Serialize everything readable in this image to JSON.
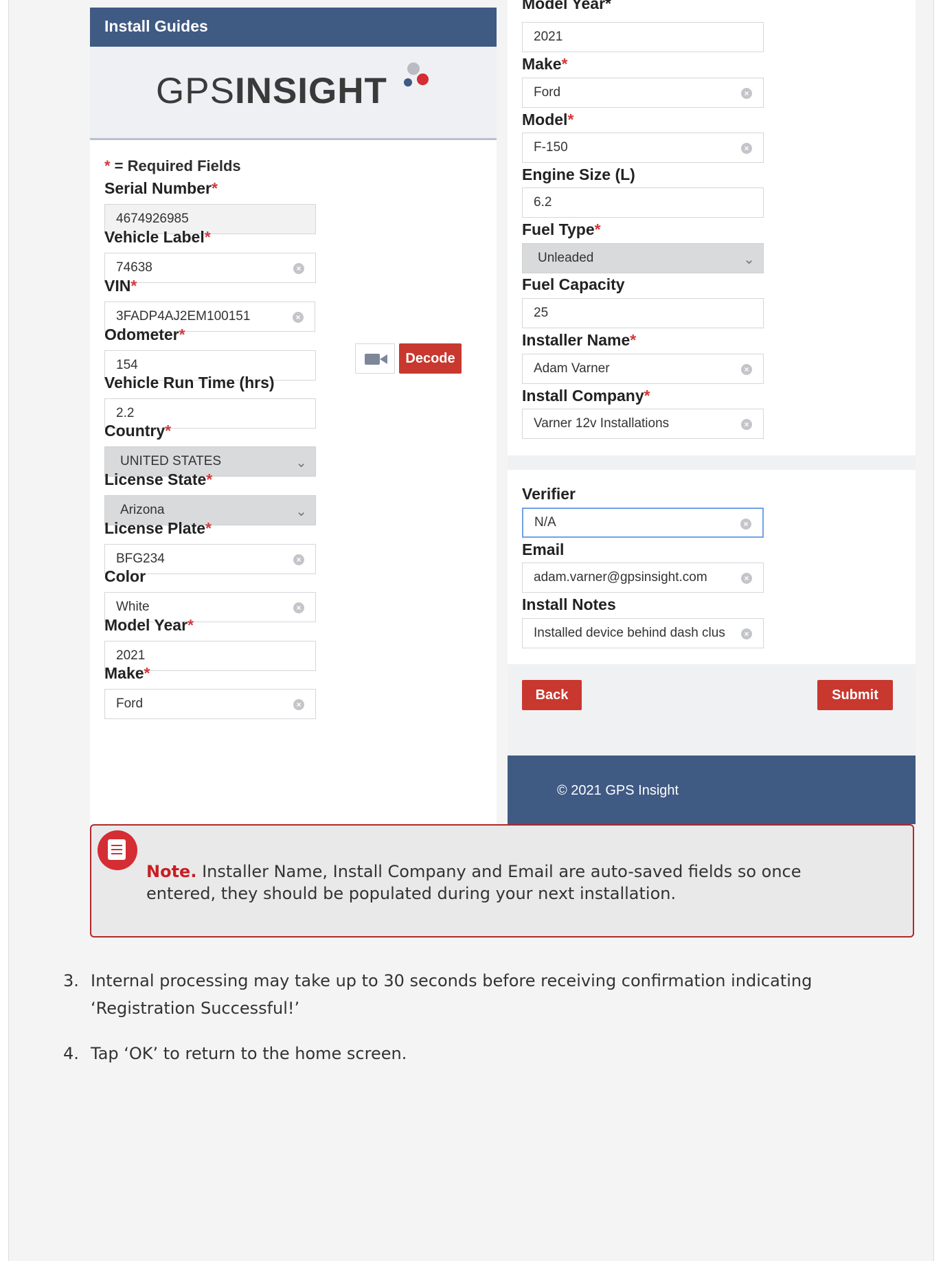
{
  "left_form": {
    "header_title": "Install Guides",
    "logo": {
      "light": "GPS",
      "bold": "INSIGHT"
    },
    "required_note": {
      "star": "*",
      "text": " = Required Fields"
    },
    "fields": [
      {
        "label": "Serial Number",
        "required": true,
        "value": "4674926985",
        "type": "readonly"
      },
      {
        "label": "Vehicle Label",
        "required": true,
        "value": "74638",
        "type": "text"
      },
      {
        "label": "VIN",
        "required": true,
        "value": "3FADP4AJ2EM100151",
        "type": "text"
      },
      {
        "label": "Odometer",
        "required": true,
        "value": "154",
        "type": "text"
      },
      {
        "label": "Vehicle Run Time (hrs)",
        "required": false,
        "value": "2.2",
        "type": "text"
      },
      {
        "label": "Country",
        "required": true,
        "value": "UNITED STATES",
        "type": "select"
      },
      {
        "label": "License State",
        "required": true,
        "value": "Arizona",
        "type": "select"
      },
      {
        "label": "License Plate",
        "required": true,
        "value": "BFG234",
        "type": "text"
      },
      {
        "label": "Color",
        "required": false,
        "value": "White",
        "type": "text"
      },
      {
        "label": "Model Year",
        "required": true,
        "value": "2021",
        "type": "text"
      },
      {
        "label": "Make",
        "required": true,
        "value": "Ford",
        "type": "text"
      }
    ],
    "decode_label": "Decode"
  },
  "right_form": {
    "top_label": "Model Year*",
    "fields": [
      {
        "label": "",
        "required": false,
        "value": "2021",
        "type": "text"
      },
      {
        "label": "Make",
        "required": true,
        "value": "Ford",
        "type": "text"
      },
      {
        "label": "Model",
        "required": true,
        "value": "F-150",
        "type": "text"
      },
      {
        "label": "Engine Size (L)",
        "required": false,
        "value": "6.2",
        "type": "text"
      },
      {
        "label": "Fuel Type",
        "required": true,
        "value": "Unleaded",
        "type": "select"
      },
      {
        "label": "Fuel Capacity",
        "required": false,
        "value": "25",
        "type": "text"
      },
      {
        "label": "Installer Name",
        "required": true,
        "value": "Adam Varner",
        "type": "text"
      },
      {
        "label": "Install Company",
        "required": true,
        "value": "Varner 12v Installations",
        "type": "text"
      },
      {
        "label": "Verifier",
        "required": false,
        "value": "N/A",
        "type": "focused"
      },
      {
        "label": "Email",
        "required": false,
        "value": "adam.varner@gpsinsight.com",
        "type": "text"
      },
      {
        "label": "Install Notes",
        "required": false,
        "value": "Installed device behind dash clus",
        "type": "text"
      }
    ],
    "back_label": "Back",
    "submit_label": "Submit",
    "footer": "© 2021 GPS Insight"
  },
  "note": {
    "label": "Note.",
    "text": " Installer Name, Install Company and Email are auto-saved fields so once entered, they should be populated during your next installation."
  },
  "steps": [
    {
      "num": "3.",
      "text": "Internal processing may take up to 30 seconds before receiving confirmation indicating ‘Registration Successful!’"
    },
    {
      "num": "4.",
      "text": "Tap ‘OK’ to return to the home screen."
    }
  ],
  "colors": {
    "accent_red": "#c8382f",
    "header_blue": "#3f5a83",
    "logo_blue": "#3f5a83",
    "logo_red": "#d42d33",
    "logo_gray": "#b9bcc2"
  }
}
